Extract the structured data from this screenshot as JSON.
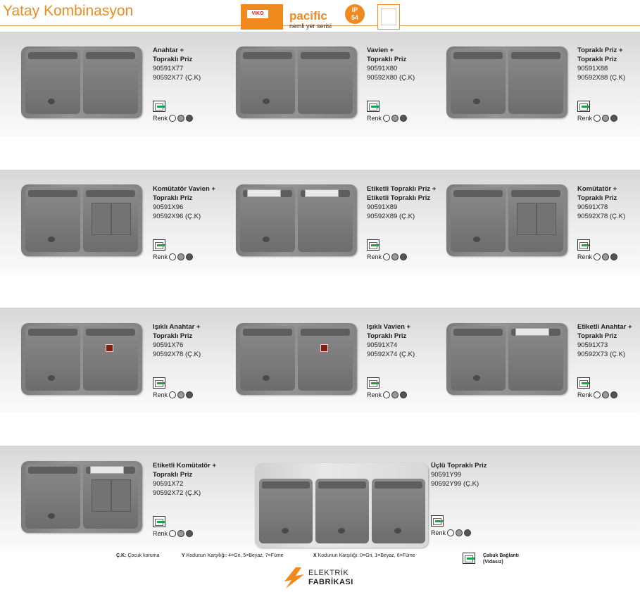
{
  "header": {
    "title": "Yatay Kombinasyon",
    "brand": "VIKO",
    "series_name": "pacific",
    "series_desc": "nemli yer serisi",
    "ip_top": "IP",
    "ip_bottom": "54"
  },
  "products": [
    {
      "name1": "Anahtar +",
      "name2": "Topraklı Priz",
      "code1": "90591X77",
      "code2": "90592X77 (Ç.K)"
    },
    {
      "name1": "Vavien +",
      "name2": "Topraklı Priz",
      "code1": "90591X80",
      "code2": "90592X80 (Ç.K)"
    },
    {
      "name1": "Topraklı Priz +",
      "name2": "Topraklı Priz",
      "code1": "90591X88",
      "code2": "90592X88 (Ç.K)"
    },
    {
      "name1": "Komütatör Vavien +",
      "name2": "Topraklı Priz",
      "code1": "90591X96",
      "code2": "90592X96 (Ç.K)"
    },
    {
      "name1": "Etiketli Topraklı Priz +",
      "name2": "Etiketli Topraklı Priz",
      "code1": "90591X89",
      "code2": "90592X89 (Ç.K)"
    },
    {
      "name1": "Komütatör +",
      "name2": "Topraklı Priz",
      "code1": "90591X78",
      "code2": "90592X78 (Ç.K)"
    },
    {
      "name1": "Işıklı Anahtar +",
      "name2": "Topraklı Priz",
      "code1": "90591X76",
      "code2": "90592X78 (Ç.K)"
    },
    {
      "name1": "Işıklı Vavien +",
      "name2": "Topraklı Priz",
      "code1": "90591X74",
      "code2": "90592X74 (Ç.K)"
    },
    {
      "name1": "Etiketli Anahtar +",
      "name2": "Topraklı Priz",
      "code1": "90591X73",
      "code2": "90592X73 (Ç.K)"
    },
    {
      "name1": "Etiketli Komütatör +",
      "name2": "Topraklı Priz",
      "code1": "90591X72",
      "code2": "90592X72 (Ç.K)"
    },
    {
      "name1": "Üçlü Topraklı Priz",
      "name2": "",
      "code1": "90591Y99",
      "code2": "90592Y99 (Ç.K)"
    }
  ],
  "renk_label": "Renk",
  "colors": {
    "white": "#ffffff",
    "grey": "#9a9a9a",
    "smoke": "#555555",
    "accent": "#f08a1e",
    "quick_connect": "#1aa44a"
  },
  "footer": {
    "ck_key": "Ç.K:",
    "ck_text": "Çocuk koruma",
    "y_key": "Y",
    "y_text": "Kodunun Karşılığı: 4=Gri, 5=Beyaz, 7=Füme",
    "x_key": "X",
    "x_text": "Kodunun Karşılığı: 0=Gri, 1=Beyaz, 6=Füme",
    "quick_title": "Çabuk Bağlantı",
    "quick_sub": "(Vidasız)",
    "logo_line1": "ELEKTRİK",
    "logo_line2": "FABRİKASI"
  }
}
